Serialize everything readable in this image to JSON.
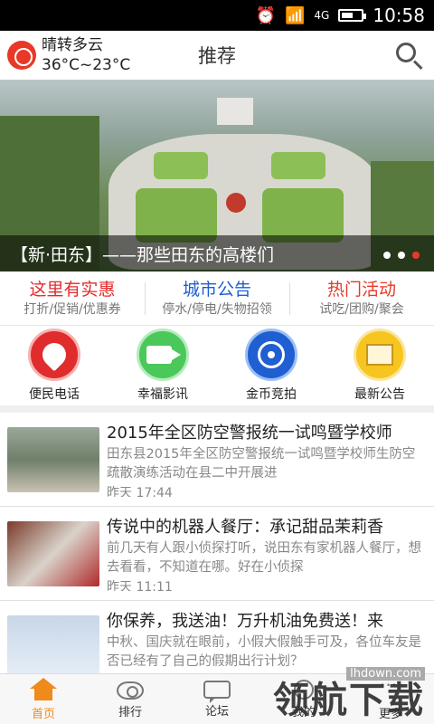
{
  "status_bar": {
    "time": "10:58",
    "network": "4G"
  },
  "header": {
    "weather_desc": "晴转多云",
    "weather_temp": "36°C~23°C",
    "title": "推荐"
  },
  "banner": {
    "caption": "【新·田东】——那些田东的高楼们",
    "slide_count": 3,
    "active_slide": 3
  },
  "quick_links": [
    {
      "title": "这里有实惠",
      "sub": "打折/促销/优惠券",
      "color": "#e02c2c"
    },
    {
      "title": "城市公告",
      "sub": "停水/停电/失物招领",
      "color": "#1f5fd1"
    },
    {
      "title": "热门活动",
      "sub": "试吃/团购/聚会",
      "color": "#e83828"
    }
  ],
  "services": [
    {
      "label": "便民电话",
      "icon": "rocket-icon"
    },
    {
      "label": "幸福影讯",
      "icon": "video-camera-icon"
    },
    {
      "label": "金币竞拍",
      "icon": "coin-icon"
    },
    {
      "label": "最新公告",
      "icon": "notice-icon"
    }
  ],
  "news": [
    {
      "title": "2015年全区防空警报统一试鸣暨学校师",
      "desc": "田东县2015年全区防空警报统一试鸣暨学校师生防空疏散演练活动在县二中开展进",
      "time": "昨天 17:44"
    },
    {
      "title": "传说中的机器人餐厅：承记甜品茉莉香",
      "desc": "前几天有人跟小侦探打听，说田东有家机器人餐厅，想去看看，不知道在哪。好在小侦探",
      "time": "昨天 11:11"
    },
    {
      "title": "你保养，我送油！万升机油免费送！来",
      "desc": "中秋、国庆就在眼前，小假大假触手可及，各位车友是否已经有了自己的假期出行计划？",
      "time": ""
    }
  ],
  "bottom_nav": [
    {
      "label": "首页",
      "icon": "home-icon",
      "active": true
    },
    {
      "label": "排行",
      "icon": "eye-icon",
      "active": false
    },
    {
      "label": "论坛",
      "icon": "chat-icon",
      "active": false
    },
    {
      "label": "我的",
      "icon": "user-icon",
      "active": false
    },
    {
      "label": "更多",
      "icon": "more-icon",
      "active": false
    }
  ],
  "watermark": {
    "url": "lhdown.com",
    "text": "领航下载"
  }
}
